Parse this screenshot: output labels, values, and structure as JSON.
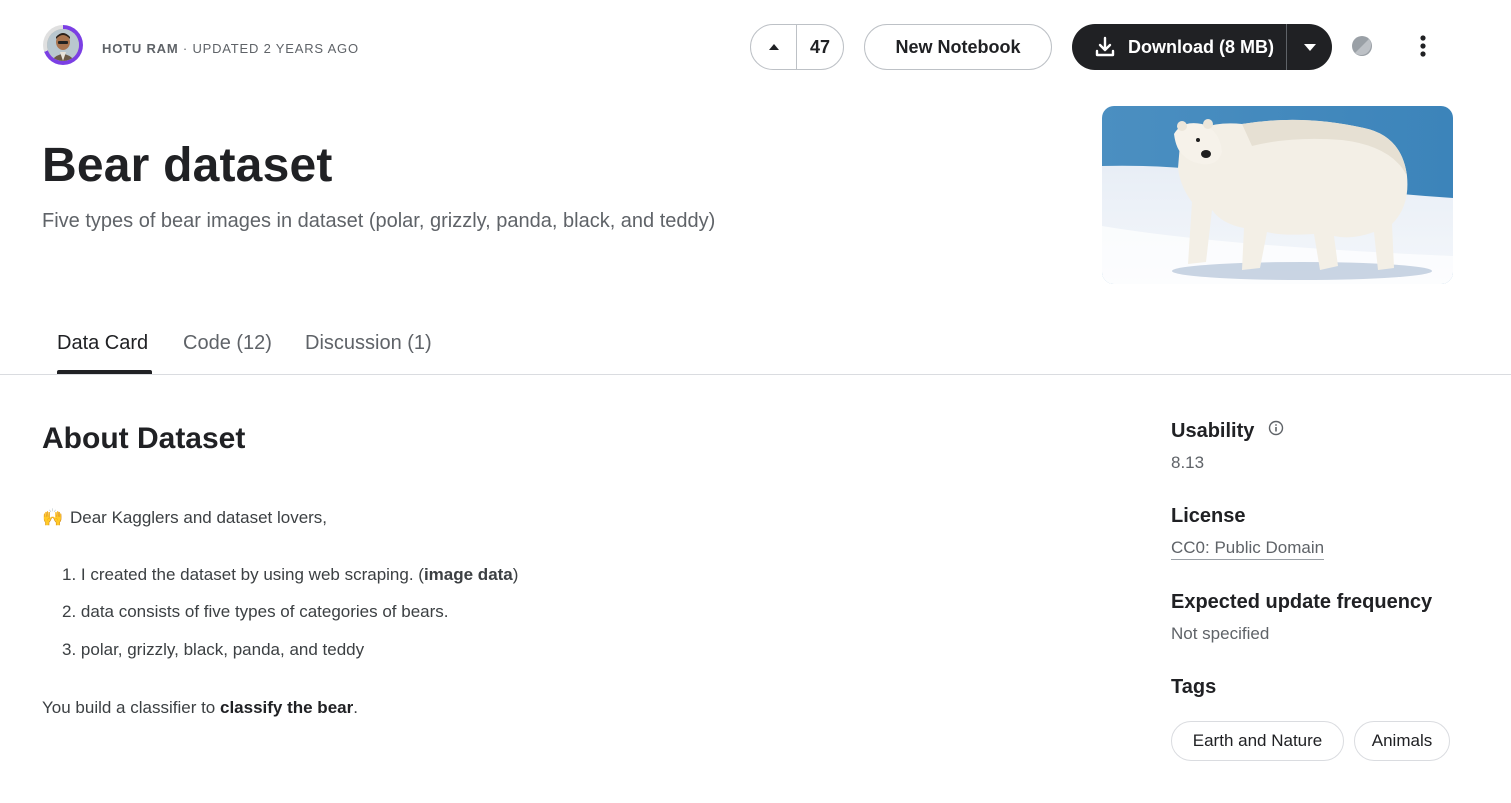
{
  "header": {
    "author": "HOTU RAM",
    "updated": "UPDATED 2 YEARS AGO",
    "separator": "·",
    "vote_count": "47",
    "new_notebook_label": "New Notebook",
    "download_label": "Download (8 MB)"
  },
  "dataset": {
    "title": "Bear dataset",
    "subtitle": "Five types of bear images in dataset (polar, grizzly, panda, black, and teddy)"
  },
  "tabs": [
    {
      "label": "Data Card",
      "active": true
    },
    {
      "label": "Code (12)",
      "active": false
    },
    {
      "label": "Discussion (1)",
      "active": false
    }
  ],
  "about": {
    "heading": "About Dataset",
    "greeting_emoji": "🙌",
    "greeting": "Dear Kagglers and dataset lovers,",
    "list": [
      {
        "num": "1.",
        "text": "I created the dataset by using web scraping. (",
        "bold": "image data",
        "after": ")"
      },
      {
        "num": "2.",
        "text": "data consists of five types of categories of bears.",
        "bold": "",
        "after": ""
      },
      {
        "num": "3.",
        "text": "polar, grizzly, black, panda, and teddy",
        "bold": "",
        "after": ""
      }
    ],
    "closing_prefix": "You build a classifier to ",
    "closing_bold": "classify the bear",
    "closing_suffix": "."
  },
  "sidebar": {
    "usability_label": "Usability",
    "usability_value": "8.13",
    "license_label": "License",
    "license_value": "CC0: Public Domain",
    "frequency_label": "Expected update frequency",
    "frequency_value": "Not specified",
    "tags_label": "Tags",
    "tags": [
      "Earth and Nature",
      "Animals"
    ]
  },
  "icons": {
    "vote": "caret-up-icon",
    "download": "download-icon",
    "dropdown": "chevron-down-icon",
    "theme": "contrast-icon",
    "more": "more-vert-icon",
    "info": "info-icon"
  },
  "colors": {
    "accent_ring": "#7b3fe4",
    "primary_button": "#202124"
  }
}
